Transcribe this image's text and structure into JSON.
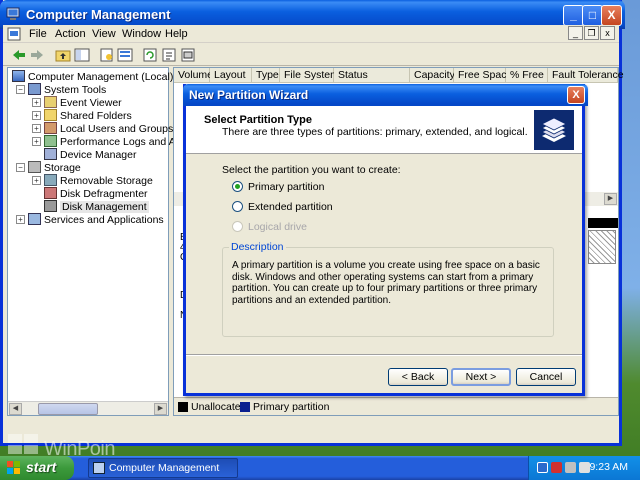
{
  "window": {
    "title": "Computer Management",
    "minimize": "_",
    "maximize": "□",
    "close": "X"
  },
  "menu": [
    "File",
    "Action",
    "View",
    "Window",
    "Help"
  ],
  "tree": {
    "root": "Computer Management (Local)",
    "system_tools": "System Tools",
    "event_viewer": "Event Viewer",
    "shared_folders": "Shared Folders",
    "local_users": "Local Users and Groups",
    "perf_logs": "Performance Logs and Alerts",
    "device_manager": "Device Manager",
    "storage": "Storage",
    "removable_storage": "Removable Storage",
    "disk_defrag": "Disk Defragmenter",
    "disk_mgmt": "Disk Management",
    "services_apps": "Services and Applications"
  },
  "columns": [
    "Volume",
    "Layout",
    "Type",
    "File System",
    "Status",
    "Capacity",
    "Free Space",
    "% Free",
    "Fault Tolerance"
  ],
  "pane_fragments": [
    "B",
    "4",
    "O",
    "D",
    "N"
  ],
  "legend": {
    "unallocated": "Unallocated",
    "primary": "Primary partition",
    "unallocated_color": "#000000",
    "primary_color": "#0a1f8f"
  },
  "wizard": {
    "title": "New Partition Wizard",
    "close": "X",
    "header_title": "Select Partition Type",
    "header_subtitle": "There are three types of partitions: primary, extended, and logical.",
    "prompt": "Select the partition you want to create:",
    "options": [
      {
        "label": "Primary partition",
        "checked": true,
        "disabled": false
      },
      {
        "label": "Extended partition",
        "checked": false,
        "disabled": false
      },
      {
        "label": "Logical drive",
        "checked": false,
        "disabled": true
      }
    ],
    "description_legend": "Description",
    "description": "A primary partition is a volume you create using free space on a basic disk. Windows and other operating systems can start from a primary partition. You can create up to four primary partitions or three primary partitions and an extended partition.",
    "back": "< Back",
    "next": "Next >",
    "cancel": "Cancel"
  },
  "taskbar": {
    "start": "start",
    "task": "Computer Management",
    "clock": "9:23 AM"
  },
  "watermark": "WinPoin",
  "colors": {
    "title_blue": "#0a5fdf",
    "start_green": "#3c9a3c",
    "description_legend": "#0046d5"
  }
}
